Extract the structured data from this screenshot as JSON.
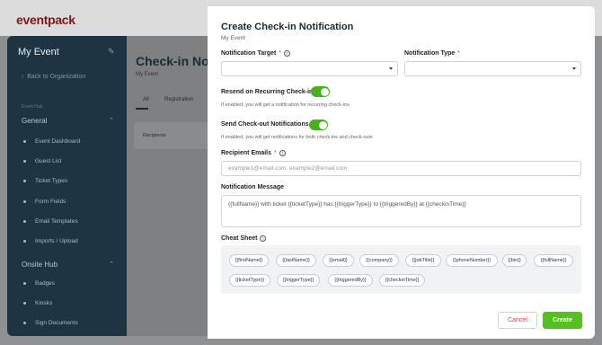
{
  "app": {
    "logo": "eventpack"
  },
  "sidebar": {
    "event_title": "My Event",
    "back_link": "Back to Organization",
    "section_label": "Event Hub",
    "groups": [
      {
        "label": "General",
        "items": [
          "Event Dashboard",
          "Guest List",
          "Ticket Types",
          "Form Fields",
          "Email Templates",
          "Imports / Upload"
        ]
      },
      {
        "label": "Onsite Hub",
        "items": [
          "Badges",
          "Kiosks",
          "Sign Documents"
        ]
      }
    ]
  },
  "page": {
    "title": "Check-in No",
    "subtitle": "My Event",
    "tabs": [
      "All",
      "Registration"
    ],
    "card_label": "Recipients"
  },
  "modal": {
    "title": "Create Check-in Notification",
    "subtitle": "My Event",
    "notification_target_label": "Notification Target",
    "notification_type_label": "Notification Type",
    "required_mark": "*",
    "resend_label": "Resend on Recurring Check-in",
    "resend_help": "If enabled, you will get a notification for recurring check-ins",
    "resend_enabled": true,
    "checkout_label": "Send Check-out Notifications",
    "checkout_help": "If enabled, you will get notifications for both check-ins and check-outs",
    "checkout_enabled": true,
    "recipient_emails_label": "Recipient Emails",
    "recipient_emails_placeholder": "example1@email.com, example2@email.com",
    "message_label": "Notification Message",
    "message_value": "{{fullName}} with ticket {{ticketType}} has {{triggerType}} to {{triggeredBy}} at {{checkinTime}}",
    "cheat_sheet_label": "Cheat Sheet",
    "cheat_chips": [
      "{{firstName}}",
      "{{lastName}}",
      "{{email}}",
      "{{company}}",
      "{{jobTitle}}",
      "{{phoneNumber}}",
      "{{bio}}",
      "{{fullName}}",
      "{{ticketType}}",
      "{{triggerType}}",
      "{{triggeredBy}}",
      "{{checkinTime}}"
    ],
    "cancel_label": "Cancel",
    "create_label": "Create"
  },
  "colors": {
    "accent_green": "#53c21f",
    "sidebar_bg": "#1e3442",
    "cancel_text": "#c94a4a"
  }
}
